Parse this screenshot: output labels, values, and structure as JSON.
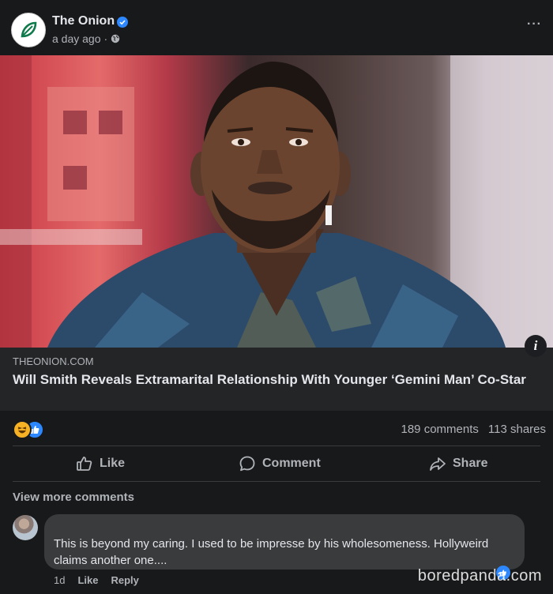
{
  "header": {
    "page_name": "The Onion",
    "time": "a day ago",
    "separator": "·",
    "more": "···",
    "logo_icon": "onion-leaf-icon",
    "verified_icon": "verified-badge-icon",
    "audience_icon": "globe-icon"
  },
  "photo": {
    "subject": "man-portrait-photo"
  },
  "link": {
    "domain": "THEONION.COM",
    "title": "Will Smith Reveals Extramarital Relationship With Younger ‘Gemini Man’ Co-Star",
    "info": "i"
  },
  "stats": {
    "comments": "189 comments",
    "shares": "113 shares",
    "reaction_icons": [
      "haha-icon",
      "like-icon"
    ]
  },
  "actions": {
    "like": "Like",
    "comment": "Comment",
    "share": "Share"
  },
  "comments": {
    "view_more": "View more comments",
    "items": [
      {
        "text": "This is beyond my caring. I used to be impresse by his wholesomeness. Hollyweird claims another one....",
        "time": "1d",
        "like": "Like",
        "reply": "Reply"
      }
    ]
  },
  "watermark": "boredpanda.com",
  "colors": {
    "background": "#18191a",
    "link_box": "#242526",
    "bubble": "#3a3b3c",
    "accent_blue": "#2d88ff",
    "onion_green": "#0f7a4a"
  }
}
